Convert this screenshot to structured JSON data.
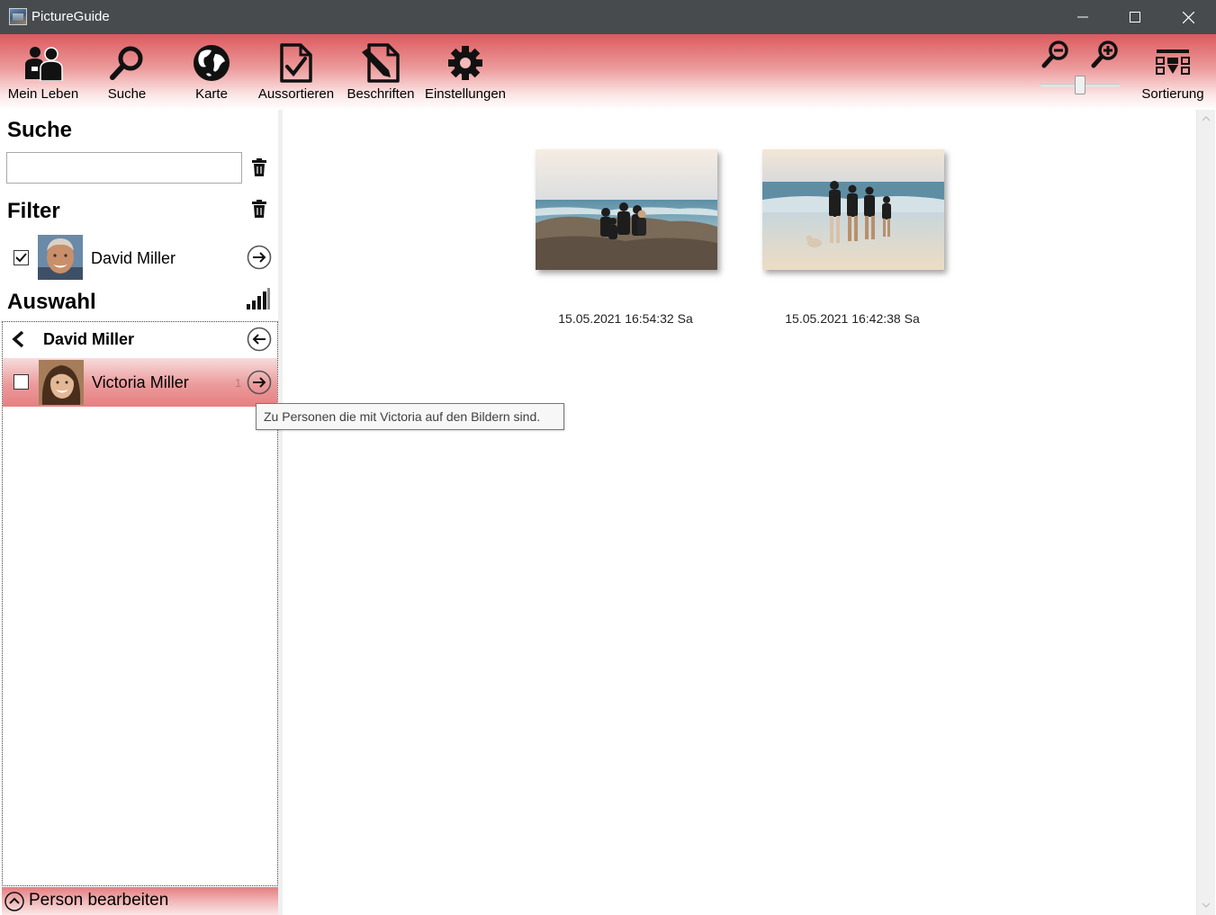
{
  "window": {
    "title": "PictureGuide",
    "controls": [
      "minimize",
      "maximize",
      "close"
    ]
  },
  "toolbar": {
    "items": [
      {
        "label": "Mein Leben",
        "icon": "people-icon"
      },
      {
        "label": "Suche",
        "icon": "search-icon"
      },
      {
        "label": "Karte",
        "icon": "globe-icon"
      },
      {
        "label": "Aussortieren",
        "icon": "document-check-icon"
      },
      {
        "label": "Beschriften",
        "icon": "document-edit-icon"
      },
      {
        "label": "Einstellungen",
        "icon": "gear-icon"
      }
    ],
    "zoom": {
      "out_icon": "zoom-out-icon",
      "in_icon": "zoom-in-icon",
      "level_fraction": 0.5
    },
    "sort": {
      "label": "Sortierung",
      "icon": "sort-grid-icon"
    }
  },
  "sidebar": {
    "search": {
      "title": "Suche",
      "value": "",
      "placeholder": ""
    },
    "filter": {
      "title": "Filter",
      "items": [
        {
          "name": "David Miller",
          "checked": true
        }
      ]
    },
    "selection": {
      "title": "Auswahl",
      "current": "David Miller",
      "items": [
        {
          "name": "Victoria Miller",
          "checked": false,
          "count": "1"
        }
      ]
    },
    "edit_person_label": "Person bearbeiten"
  },
  "photos": [
    {
      "caption": "15.05.2021 16:54:32 Sa"
    },
    {
      "caption": "15.05.2021 16:42:38 Sa"
    }
  ],
  "tooltip": "Zu Personen die mit Victoria auf den Bildern sind.",
  "colors": {
    "titlebar": "#474b4e",
    "accent_red": "#dc5a5e",
    "selection_row": "#eb9a9b"
  }
}
